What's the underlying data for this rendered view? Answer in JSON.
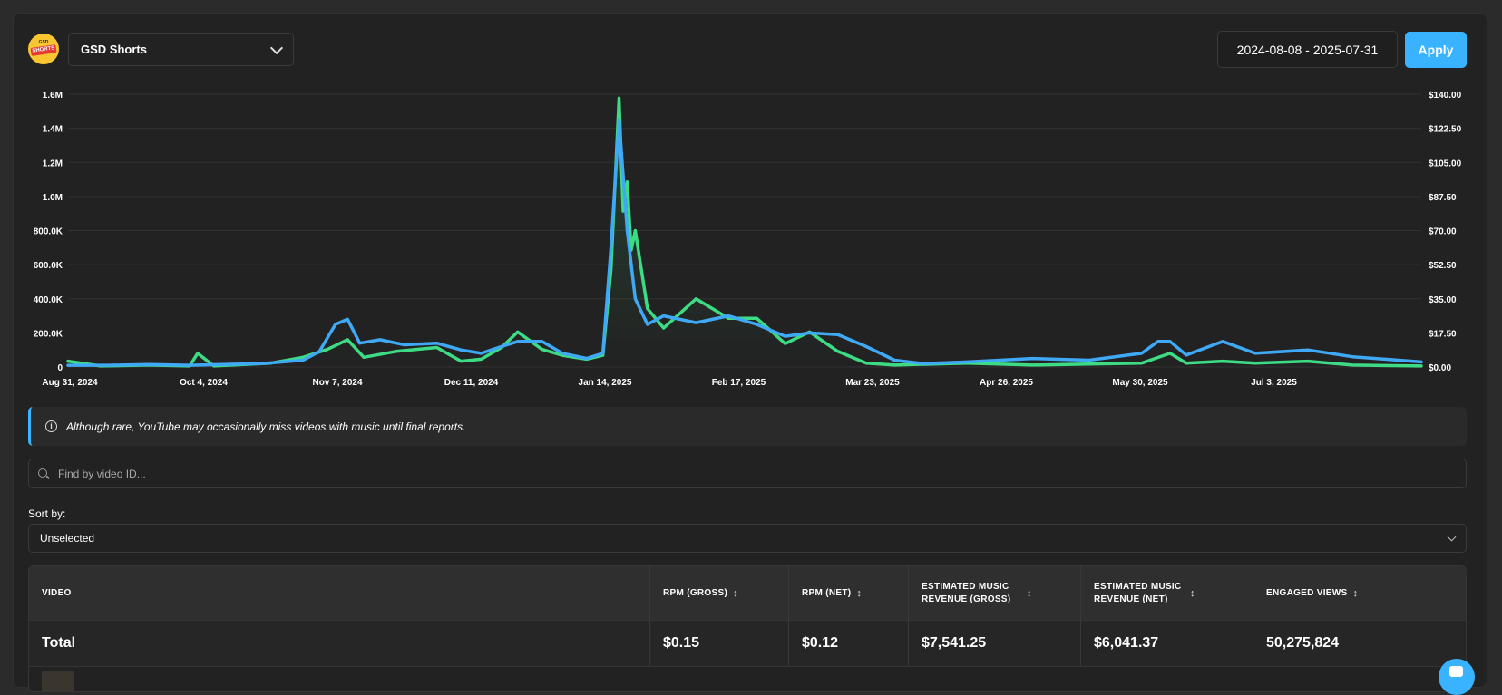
{
  "channel": {
    "name": "GSD Shorts",
    "logo_text_top": "GSD",
    "logo_text_band": "SHORTS"
  },
  "date_range": {
    "value": "2024-08-08 - 2025-07-31"
  },
  "apply_label": "Apply",
  "notice": {
    "text": "Although rare, YouTube may occasionally miss videos with music until final reports."
  },
  "search": {
    "placeholder": "Find by video ID..."
  },
  "sort": {
    "label": "Sort by:",
    "value": "Unselected"
  },
  "table": {
    "columns": [
      {
        "label": "VIDEO",
        "sortable": false
      },
      {
        "label": "RPM (GROSS)",
        "sortable": true
      },
      {
        "label": "RPM (NET)",
        "sortable": true
      },
      {
        "label": "ESTIMATED MUSIC REVENUE (GROSS)",
        "sortable": true
      },
      {
        "label": "ESTIMATED MUSIC REVENUE (NET)",
        "sortable": true
      },
      {
        "label": "ENGAGED VIEWS",
        "sortable": true
      }
    ],
    "total_row": [
      "Total",
      "$0.15",
      "$0.12",
      "$7,541.25",
      "$6,041.37",
      "50,275,824"
    ]
  },
  "colors": {
    "accent": "#39b3ff",
    "views_line": "#3fa9f5",
    "revenue_line": "#3ddc84",
    "background": "#222222"
  },
  "chart_data": {
    "type": "line",
    "x_tick_labels": [
      "Aug 31, 2024",
      "Oct 4, 2024",
      "Nov 7, 2024",
      "Dec 11, 2024",
      "Jan 14, 2025",
      "Feb 17, 2025",
      "Mar 23, 2025",
      "Apr 26, 2025",
      "May 30, 2025",
      "Jul 3, 2025"
    ],
    "x_range": [
      "2024-08-31",
      "2025-07-31"
    ],
    "y_left_ticks": [
      "0",
      "200.0K",
      "400.0K",
      "600.0K",
      "800.0K",
      "1.0M",
      "1.2M",
      "1.4M",
      "1.6M"
    ],
    "y_left_range": [
      0,
      1600000
    ],
    "y_right_ticks": [
      "$0.00",
      "$17.50",
      "$35.00",
      "$52.50",
      "$70.00",
      "$87.50",
      "$105.00",
      "$122.50",
      "$140.00"
    ],
    "y_right_range": [
      0,
      140
    ],
    "grid": true,
    "series": [
      {
        "axis": "left",
        "color": "#3fa9f5",
        "points": [
          [
            "2024-08-31",
            10000
          ],
          [
            "2024-09-10",
            10000
          ],
          [
            "2024-09-20",
            15000
          ],
          [
            "2024-09-30",
            10000
          ],
          [
            "2024-10-08",
            15000
          ],
          [
            "2024-10-18",
            20000
          ],
          [
            "2024-10-28",
            40000
          ],
          [
            "2024-11-01",
            90000
          ],
          [
            "2024-11-05",
            250000
          ],
          [
            "2024-11-08",
            280000
          ],
          [
            "2024-11-11",
            140000
          ],
          [
            "2024-11-16",
            160000
          ],
          [
            "2024-11-22",
            130000
          ],
          [
            "2024-11-30",
            140000
          ],
          [
            "2024-12-06",
            100000
          ],
          [
            "2024-12-11",
            80000
          ],
          [
            "2024-12-16",
            120000
          ],
          [
            "2024-12-20",
            150000
          ],
          [
            "2024-12-26",
            150000
          ],
          [
            "2024-12-31",
            80000
          ],
          [
            "2025-01-06",
            50000
          ],
          [
            "2025-01-10",
            80000
          ],
          [
            "2025-01-12",
            700000
          ],
          [
            "2025-01-14",
            1450000
          ],
          [
            "2025-01-16",
            800000
          ],
          [
            "2025-01-18",
            400000
          ],
          [
            "2025-01-21",
            250000
          ],
          [
            "2025-01-25",
            300000
          ],
          [
            "2025-02-02",
            260000
          ],
          [
            "2025-02-10",
            300000
          ],
          [
            "2025-02-17",
            250000
          ],
          [
            "2025-02-24",
            180000
          ],
          [
            "2025-03-02",
            200000
          ],
          [
            "2025-03-09",
            190000
          ],
          [
            "2025-03-16",
            120000
          ],
          [
            "2025-03-23",
            40000
          ],
          [
            "2025-03-30",
            20000
          ],
          [
            "2025-04-10",
            30000
          ],
          [
            "2025-04-26",
            50000
          ],
          [
            "2025-05-10",
            40000
          ],
          [
            "2025-05-23",
            80000
          ],
          [
            "2025-05-27",
            150000
          ],
          [
            "2025-05-30",
            150000
          ],
          [
            "2025-06-03",
            70000
          ],
          [
            "2025-06-12",
            150000
          ],
          [
            "2025-06-20",
            80000
          ],
          [
            "2025-07-03",
            100000
          ],
          [
            "2025-07-14",
            60000
          ],
          [
            "2025-07-31",
            30000
          ]
        ]
      },
      {
        "axis": "right",
        "color": "#3ddc84",
        "points": [
          [
            "2024-08-31",
            3
          ],
          [
            "2024-09-08",
            0.5
          ],
          [
            "2024-09-20",
            1
          ],
          [
            "2024-09-30",
            0.5
          ],
          [
            "2024-10-02",
            7
          ],
          [
            "2024-10-06",
            0.5
          ],
          [
            "2024-10-20",
            2
          ],
          [
            "2024-10-28",
            5
          ],
          [
            "2024-11-03",
            9
          ],
          [
            "2024-11-08",
            14
          ],
          [
            "2024-11-12",
            5
          ],
          [
            "2024-11-20",
            8
          ],
          [
            "2024-11-30",
            10
          ],
          [
            "2024-12-06",
            3
          ],
          [
            "2024-12-11",
            4
          ],
          [
            "2024-12-16",
            10
          ],
          [
            "2024-12-20",
            18
          ],
          [
            "2024-12-26",
            9
          ],
          [
            "2024-12-31",
            6
          ],
          [
            "2025-01-06",
            4
          ],
          [
            "2025-01-10",
            6
          ],
          [
            "2025-01-12",
            50
          ],
          [
            "2025-01-14",
            138
          ],
          [
            "2025-01-15",
            80
          ],
          [
            "2025-01-16",
            95
          ],
          [
            "2025-01-17",
            60
          ],
          [
            "2025-01-18",
            70
          ],
          [
            "2025-01-21",
            30
          ],
          [
            "2025-01-25",
            20
          ],
          [
            "2025-02-02",
            35
          ],
          [
            "2025-02-10",
            25
          ],
          [
            "2025-02-17",
            25
          ],
          [
            "2025-02-24",
            12
          ],
          [
            "2025-03-02",
            18
          ],
          [
            "2025-03-09",
            8
          ],
          [
            "2025-03-16",
            2
          ],
          [
            "2025-03-23",
            1
          ],
          [
            "2025-04-10",
            2
          ],
          [
            "2025-04-26",
            1
          ],
          [
            "2025-05-10",
            1.5
          ],
          [
            "2025-05-23",
            2
          ],
          [
            "2025-05-30",
            7
          ],
          [
            "2025-06-03",
            2
          ],
          [
            "2025-06-12",
            3
          ],
          [
            "2025-06-20",
            2
          ],
          [
            "2025-07-03",
            3
          ],
          [
            "2025-07-14",
            1
          ],
          [
            "2025-07-31",
            0.5
          ]
        ]
      }
    ]
  }
}
